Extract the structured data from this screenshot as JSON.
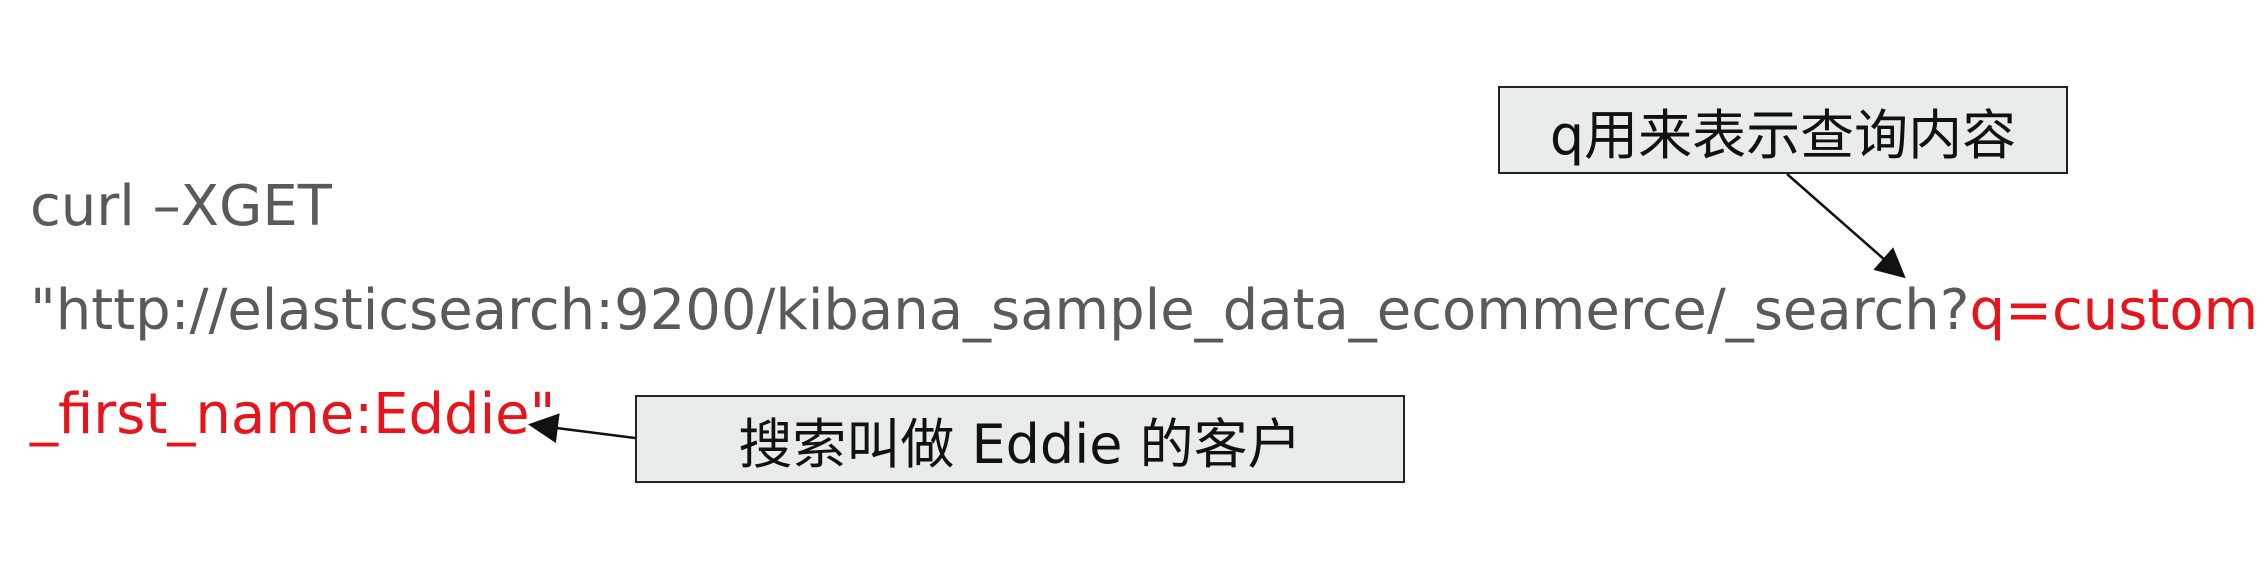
{
  "code": {
    "line1": "curl –XGET",
    "line2_prefix": "\"http://elasticsearch:9200/kibana_sample_data_ecommerce/_search?",
    "line2_highlight": "q=customer",
    "line3_highlight": "_first_name:Eddie\""
  },
  "callouts": {
    "query_param": "q用来表示查询内容",
    "search_target": "搜索叫做 Eddie 的客户"
  },
  "colors": {
    "code_text": "#5a5a5a",
    "highlight": "#e8141c",
    "callout_fill": "#e9ecec",
    "callout_border": "#222222"
  }
}
